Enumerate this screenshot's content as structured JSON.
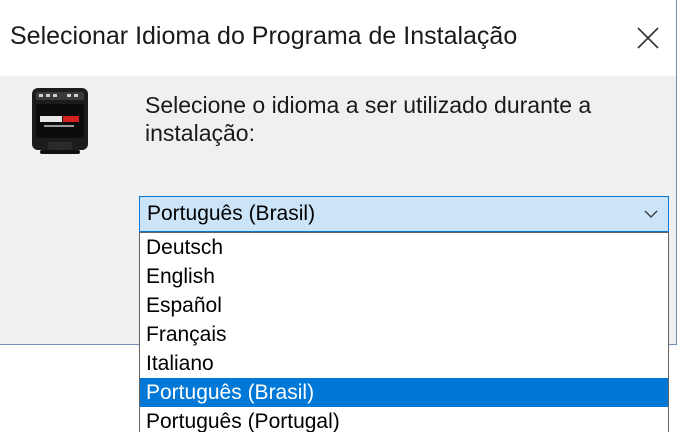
{
  "window": {
    "title": "Selecionar Idioma do Programa de Instalação",
    "close_icon": "close-icon"
  },
  "body": {
    "app_icon": "setup-app-icon",
    "prompt": "Selecione o idioma a ser utilizado durante a instalação:"
  },
  "language_combo": {
    "selected": "Português (Brasil)",
    "arrow_icon": "chevron-down-icon"
  },
  "language_options": [
    "Deutsch",
    "English",
    "Español",
    "Français",
    "Italiano",
    "Português (Brasil)",
    "Português (Portugal)"
  ],
  "highlighted_option": "Português (Brasil)",
  "colors": {
    "selection": "#0078d7",
    "combo_fill": "#cce4f7",
    "dialog_bg": "#f0f0f0"
  }
}
